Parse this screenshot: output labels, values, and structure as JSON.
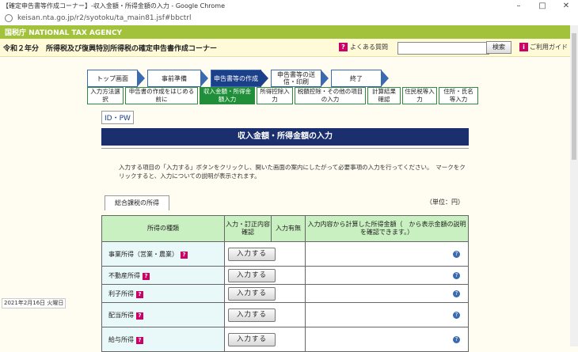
{
  "browser": {
    "title": "【確定申告書等作成コーナー】-収入金額・所得金額の入力 - Google Chrome",
    "url": "keisan.nta.go.jp/r2/syotoku/ta_main81.jsf#bbctrl"
  },
  "banner": {
    "agency": "国税庁 NATIONAL TAX AGENCY"
  },
  "header": {
    "title": "令和２年分　所得税及び復興特別所得税の確定申告書作成コーナー",
    "faq_label": "よくある質問",
    "search_placeholder": "",
    "search_button": "検索",
    "guide_label": "ご利用ガイド"
  },
  "steps": [
    {
      "label": "トップ画面"
    },
    {
      "label": "事前準備"
    },
    {
      "label": "申告書等の作成"
    },
    {
      "label": "申告書等の送信・印刷"
    },
    {
      "label": "終了"
    }
  ],
  "substeps": [
    {
      "label": "入力方法選択"
    },
    {
      "label": "申告書の作成をはじめる前に"
    },
    {
      "label": "収入金額・所得金額入力"
    },
    {
      "label": "所得控除入力"
    },
    {
      "label": "税額控除・その他の項目の入力"
    },
    {
      "label": "計算結果確認"
    },
    {
      "label": "住民税等入力"
    },
    {
      "label": "住所・氏名等入力"
    }
  ],
  "idpw": "ID・PW",
  "page_title": "収入金額・所得金額の入力",
  "instructions": "入力する項目の「入力する」ボタンをクリックし、開いた画面の案内にしたがって必要事項の入力を行ってください。　マークをクリックすると、入力についての説明が表示されます。",
  "tab_label": "総合課税の所得",
  "unit_label": "（単位：円）",
  "table": {
    "headers": [
      "所得の種類",
      "入力・訂正内容確認",
      "入力有無",
      "入力内容から計算した所得金額（　から表示金額の説明を確認できます。）"
    ],
    "button_label": "入力する",
    "rows": [
      {
        "kind": "事業所得（営業・農業）"
      },
      {
        "kind": "不動産所得"
      },
      {
        "kind": "利子所得"
      },
      {
        "kind": "配当所得"
      },
      {
        "kind": "給与所得"
      }
    ]
  },
  "date_stamp": "2021年2月16日 火曜日"
}
